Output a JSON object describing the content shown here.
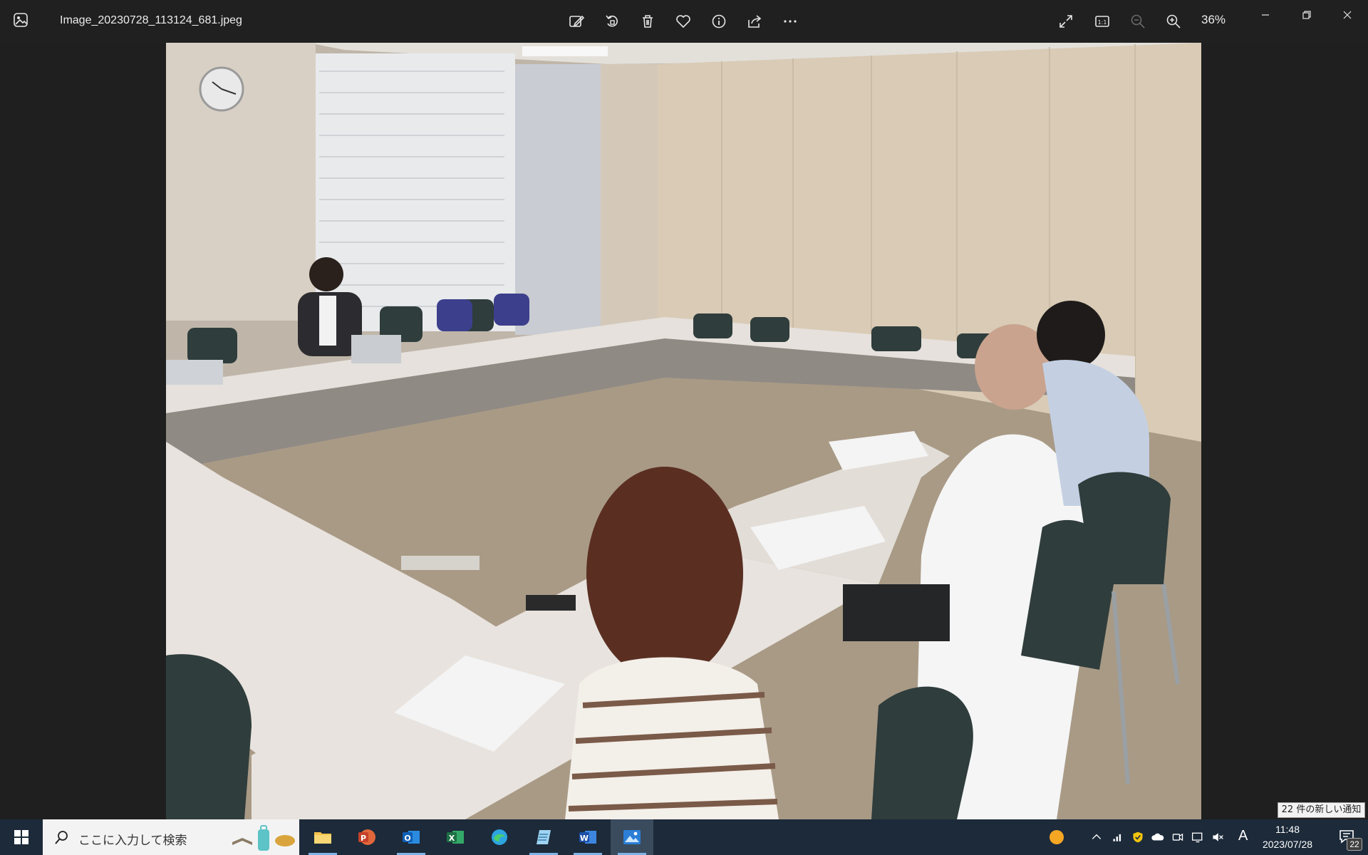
{
  "titlebar": {
    "file_name": "Image_20230728_113124_681.jpeg",
    "zoom_level": "36%",
    "toolbar_icons": [
      "edit-image-icon",
      "rotate-icon",
      "delete-icon",
      "favorite-icon",
      "info-icon",
      "share-icon",
      "more-icon"
    ],
    "view_icons": [
      "fullscreen-icon",
      "actual-size-icon",
      "zoom-out-icon",
      "zoom-in-icon"
    ],
    "window_controls": [
      "minimize-icon",
      "restore-icon",
      "close-icon"
    ]
  },
  "notification": {
    "toast_text": "22 件の新しい通知",
    "badge_count": "22"
  },
  "taskbar": {
    "search_placeholder": "ここに入力して検索",
    "apps": [
      {
        "name": "file-explorer",
        "active": false
      },
      {
        "name": "powerpoint",
        "active": false
      },
      {
        "name": "outlook",
        "active": false
      },
      {
        "name": "excel",
        "active": false
      },
      {
        "name": "edge",
        "active": false
      },
      {
        "name": "notepad",
        "active": false
      },
      {
        "name": "word",
        "active": false
      },
      {
        "name": "photos",
        "active": true
      }
    ],
    "ime": "A",
    "clock_time": "11:48",
    "clock_date": "2023/07/28"
  },
  "colors": {
    "titlebar_bg": "#202020",
    "taskbar_bg": "#1c2a3a",
    "accent": "#7fb3e6"
  }
}
